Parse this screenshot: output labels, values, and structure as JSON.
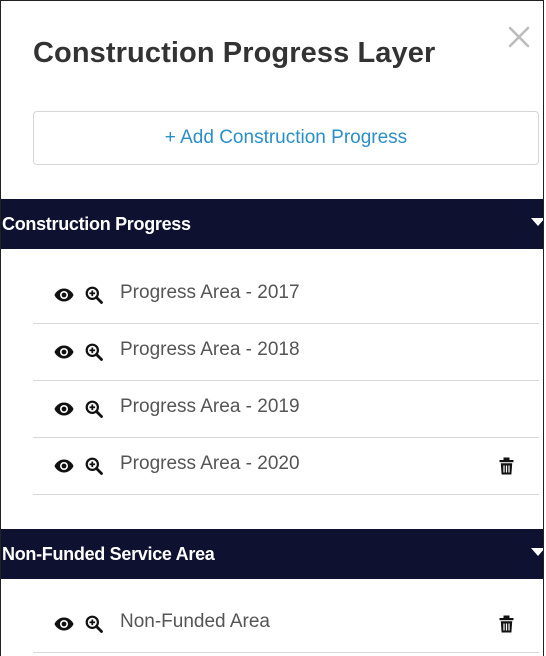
{
  "panel": {
    "title": "Construction Progress Layer",
    "add_button_label": "+ Add Construction Progress"
  },
  "icons": {
    "close": "close-icon",
    "visibility": "eye-icon",
    "zoom": "zoom-in-icon",
    "delete": "trash-icon",
    "collapse": "caret-down-icon"
  },
  "colors": {
    "header_bg": "#0e1230",
    "accent": "#2a8fc9",
    "text": "#333333"
  },
  "sections": [
    {
      "title": "Construction Progress",
      "layers": [
        {
          "label": "Progress Area - 2017"
        },
        {
          "label": "Progress Area - 2018"
        },
        {
          "label": "Progress Area - 2019"
        },
        {
          "label": "Progress Area - 2020"
        }
      ]
    },
    {
      "title": "Non-Funded Service Area",
      "layers": [
        {
          "label": "Non-Funded Area"
        }
      ]
    }
  ]
}
